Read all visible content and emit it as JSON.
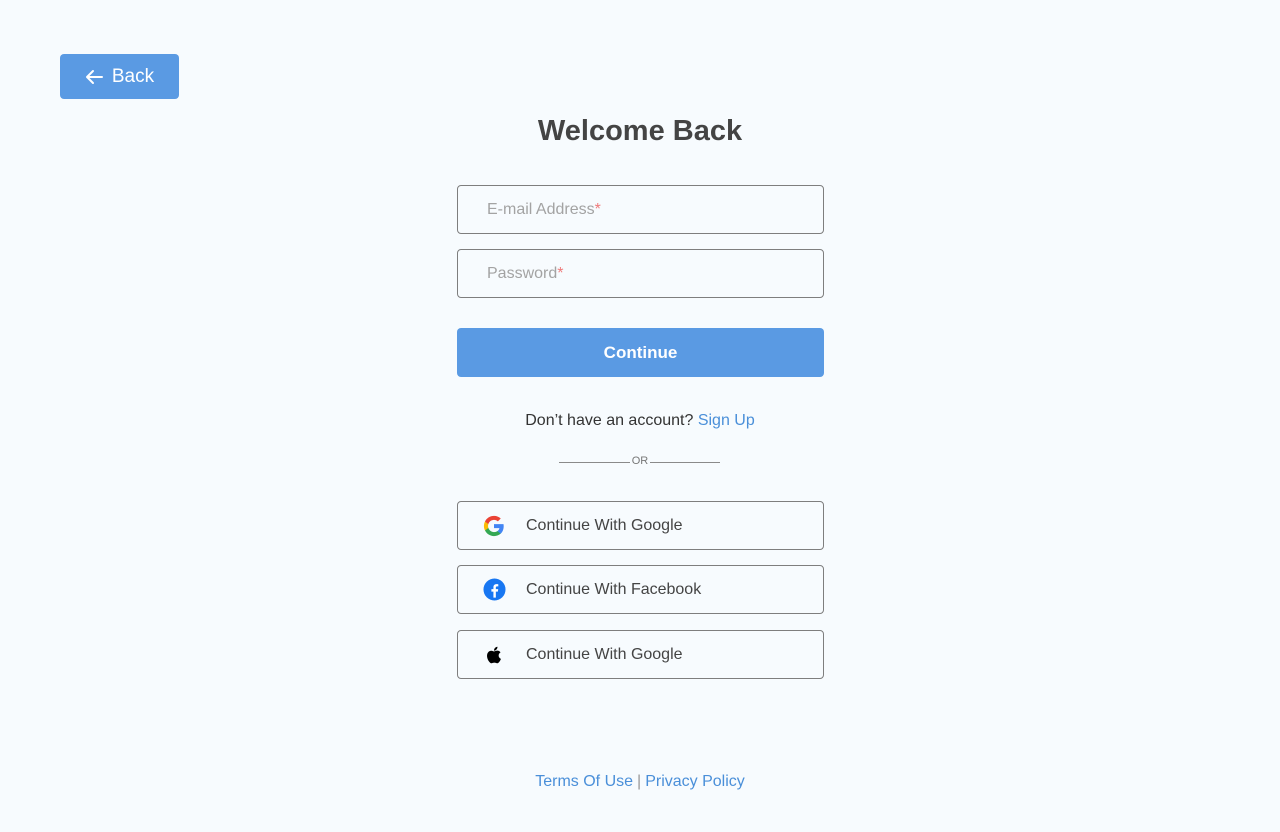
{
  "back_button": {
    "label": "Back"
  },
  "title": "Welcome Back",
  "form": {
    "email_placeholder": "E-mail Address",
    "password_placeholder": "Password",
    "required_marker": "*",
    "continue_label": "Continue"
  },
  "signup": {
    "prompt": "Don’t have an account?",
    "link_label": "Sign Up"
  },
  "divider_label": "OR",
  "social_buttons": [
    {
      "label": "Continue With Google",
      "icon": "google-icon"
    },
    {
      "label": "Continue With Facebook",
      "icon": "facebook-icon"
    },
    {
      "label": "Continue With Google",
      "icon": "apple-icon"
    }
  ],
  "footer": {
    "terms_label": "Terms Of Use",
    "separator": "|",
    "privacy_label": "Privacy Policy"
  },
  "colors": {
    "primary": "#5a9ae3",
    "link": "#4a8fd9",
    "background": "#f7fbfe",
    "required": "#ef7a7a",
    "facebook": "#1877f2"
  }
}
